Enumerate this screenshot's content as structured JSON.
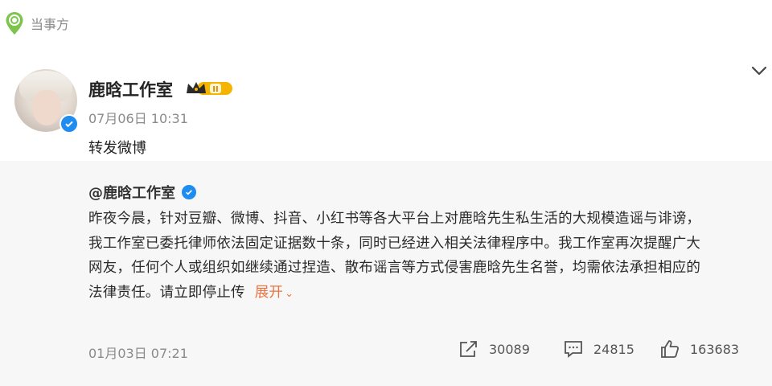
{
  "header": {
    "source_label": "当事方"
  },
  "post": {
    "author": "鹿晗工作室",
    "time": "07月06日 10:31",
    "text": "转发微博"
  },
  "repost": {
    "author": "@鹿晗工作室",
    "lines": [
      "昨夜今晨，针对豆瓣、微博、抖音、小红书等各大平台上对鹿晗先生私生活的大规模造谣与诽谤，",
      "我工作室已委托律师依法固定证据数十条，同时已经进入相关法律程序中。我工作室再次提醒广大",
      "网友，任何个人或组织如继续通过捏造、散布谣言等方式侵害鹿晗先生名誉，均需依法承担相应的",
      "法律责任。请立即停止传"
    ],
    "expand_label": "展开",
    "time": "01月03日 07:21",
    "reposts": "30089",
    "comments": "24815",
    "likes": "163683"
  },
  "colors": {
    "verified_blue": "#1f8cf0",
    "expand_orange": "#eb7340",
    "source_green": "#7cc44b",
    "vip_gold": "#f5b400"
  },
  "icons": [
    "location-pin-icon",
    "verified-icon",
    "vip-crown-icon",
    "chevron-down-icon",
    "share-icon",
    "comment-icon",
    "thumbs-up-icon"
  ]
}
